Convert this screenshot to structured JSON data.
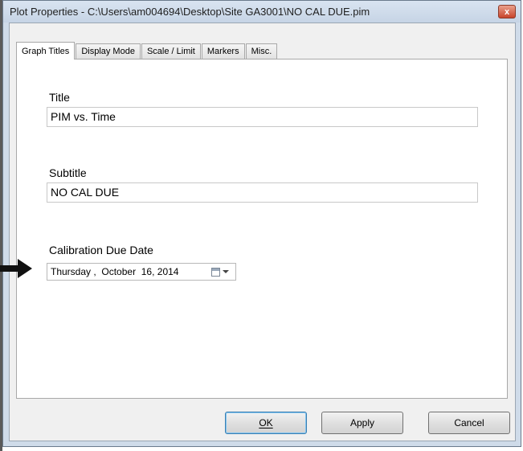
{
  "window": {
    "title": "Plot Properties - C:\\Users\\am004694\\Desktop\\Site GA3001\\NO CAL DUE.pim",
    "close_glyph": "x"
  },
  "tabs": [
    {
      "label": "Graph Titles",
      "active": true
    },
    {
      "label": "Display Mode",
      "active": false
    },
    {
      "label": "Scale / Limit",
      "active": false
    },
    {
      "label": "Markers",
      "active": false
    },
    {
      "label": "Misc.",
      "active": false
    }
  ],
  "fields": {
    "title": {
      "label": "Title",
      "value": "PIM vs. Time"
    },
    "subtitle": {
      "label": "Subtitle",
      "value": "NO CAL DUE"
    },
    "calibration": {
      "label": "Calibration Due Date",
      "weekday": "Thursday",
      "sep1": " ,  ",
      "month": "October",
      "day": "16,",
      "year": "2014"
    }
  },
  "buttons": {
    "ok": {
      "label": "OK",
      "mnemonic": "O"
    },
    "apply": {
      "label": "Apply",
      "mnemonic": "A"
    },
    "cancel": {
      "label": "Cancel",
      "mnemonic": "C"
    }
  },
  "colors": {
    "window_frame": "#cfdbe9",
    "client_bg": "#f0f0f0",
    "default_button_border": "#3c7fb1"
  },
  "icons": {
    "close": "close-icon",
    "calendar": "calendar-icon",
    "dropdown": "chevron-down-icon",
    "pointer_arrow": "arrow-right-icon"
  }
}
